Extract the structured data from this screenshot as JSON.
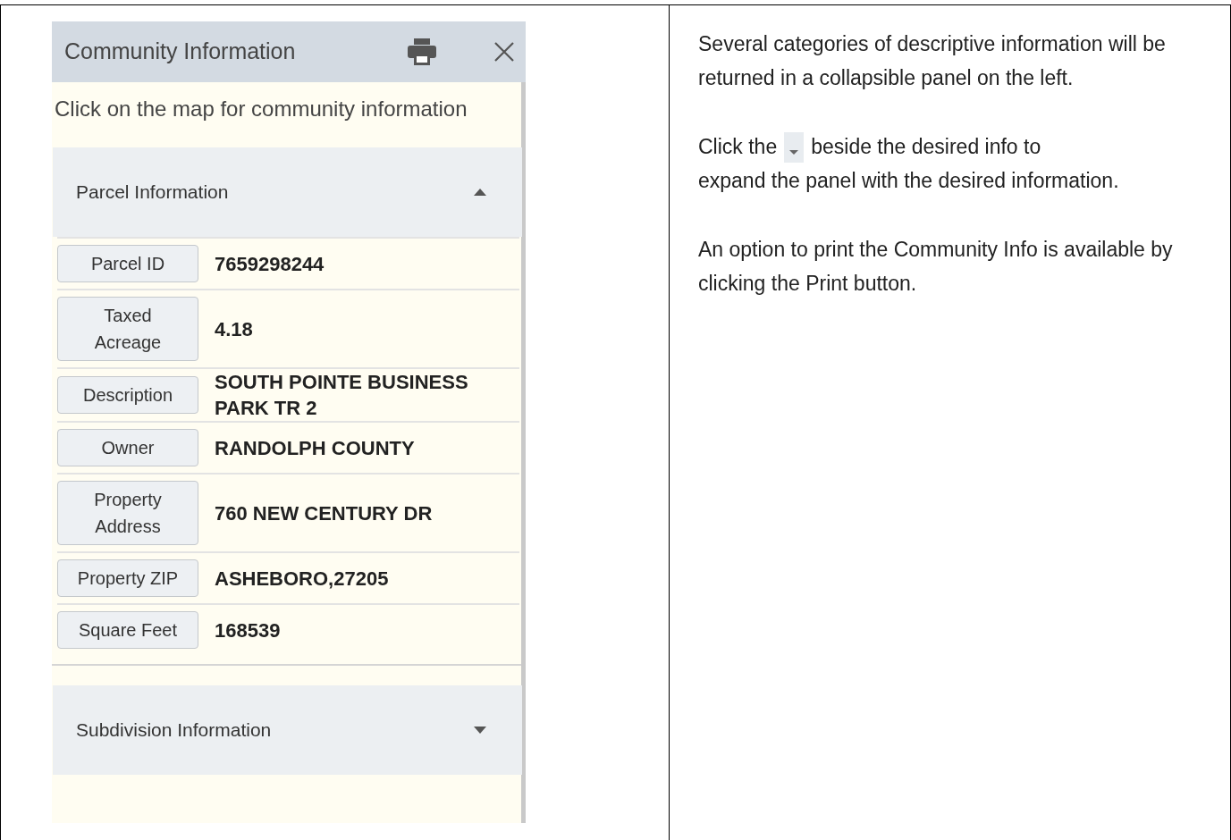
{
  "panel": {
    "title": "Community Information",
    "hint": "Click on the map for community information",
    "sections": [
      {
        "title": "Parcel Information",
        "expanded": true,
        "fields": [
          {
            "label": "Parcel ID",
            "value": "7659298244"
          },
          {
            "label": "Taxed Acreage",
            "value": "4.18"
          },
          {
            "label": "Description",
            "value": "SOUTH POINTE BUSINESS PARK TR 2"
          },
          {
            "label": "Owner",
            "value": "RANDOLPH COUNTY"
          },
          {
            "label": "Property Address",
            "value": "760 NEW CENTURY DR"
          },
          {
            "label": "Property ZIP",
            "value": "ASHEBORO,27205"
          },
          {
            "label": "Square Feet",
            "value": "168539"
          }
        ]
      },
      {
        "title": "Subdivision Information",
        "expanded": false
      }
    ]
  },
  "instructions": [
    {
      "kind": "text",
      "text": "Several categories of descriptive information will be returned in a collapsible panel on the left."
    },
    {
      "kind": "icon_inline",
      "before": "Click the",
      "after": "beside the desired info to",
      "continued": "expand the panel with the desired information."
    },
    {
      "kind": "text",
      "text": "An option to print the Community Info is available by clicking the Print button."
    }
  ]
}
